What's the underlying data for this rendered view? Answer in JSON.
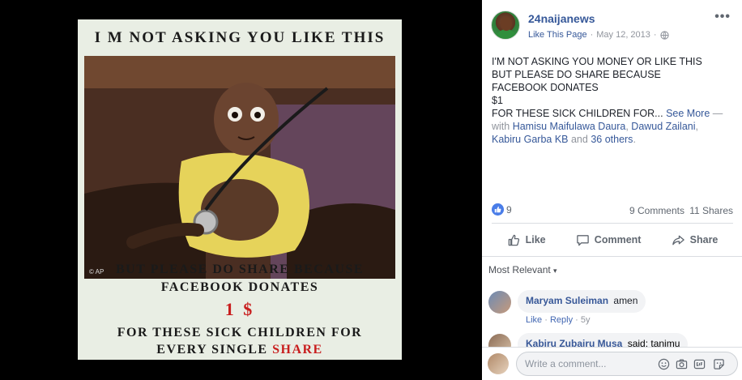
{
  "post_image": {
    "heading": "I M NOT ASKING YOU LIKE THIS",
    "watermark": "© AP",
    "line1": "BUT PLEASE DO SHARE BECAUSE",
    "line2": "FACEBOOK DONATES",
    "amount": "1 $",
    "line3": "FOR THESE SICK CHILDREN FOR",
    "line4_prefix": "EVERY SINGLE ",
    "line4_highlight": "SHARE"
  },
  "post": {
    "page_name": "24naijanews",
    "like_page": "Like This Page",
    "separator": "·",
    "date": "May 12, 2013",
    "separator2": "·",
    "more_options": "•••",
    "text_lines": [
      "I'M NOT ASKING YOU MONEY OR LIKE THIS",
      "BUT PLEASE DO SHARE BECAUSE",
      "FACEBOOK DONATES",
      "$1"
    ],
    "text_last_line": "FOR THESE SICK CHILDREN FOR... ",
    "see_more": "See More",
    "dash_with": " — ",
    "with_word": "with ",
    "tag_1": "Hamisu Maifulawa Daura",
    "comma_1": ", ",
    "tag_2": "Dawud Zailani",
    "comma_2": ",",
    "tag_3": "Kabiru Garba KB",
    "and_word": " and ",
    "others": "36 others",
    "period": "."
  },
  "stats": {
    "reactions": "9",
    "comments": "9 Comments",
    "shares": "11 Shares"
  },
  "actions": {
    "like": "Like",
    "comment": "Comment",
    "share": "Share"
  },
  "comments": {
    "sort_label": "Most Relevant",
    "sort_caret": "▾",
    "items": [
      {
        "author": "Maryam Suleiman",
        "text": "amen",
        "like": "Like",
        "dot": " · ",
        "reply": "Reply",
        "dot2": " · ",
        "age": "5y"
      },
      {
        "author": "Kabiru Zubairu Musa",
        "text": "said: tanimu"
      }
    ],
    "composer_placeholder": "Write a comment..."
  },
  "colors": {
    "link": "#365899",
    "accent_red": "#c81e1e",
    "like_blue": "#4a7de8"
  }
}
